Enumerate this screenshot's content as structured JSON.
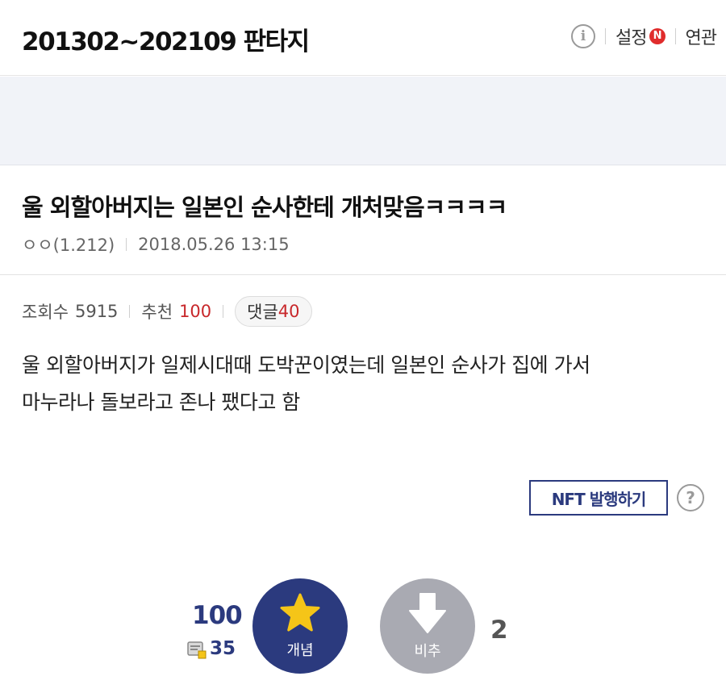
{
  "header": {
    "gallery_title": "201302~202109 판타지",
    "info_icon": "info-icon",
    "settings_label": "설정",
    "new_badge": "N",
    "related_label": "연관"
  },
  "post": {
    "title": "울 외할아버지는 일본인 순사한테 개처맞음ㅋㅋㅋㅋ",
    "author": "ㅇㅇ(1.212)",
    "date": "2018.05.26 13:15",
    "views_label": "조회수",
    "views": "5915",
    "recommend_label": "추천",
    "recommend_count": "100",
    "comments_label": "댓글",
    "comments_count": "40",
    "body_line1": "울 외할아버지가 일제시대때 도박꾼이였는데 일본인 순사가 집에 가서",
    "body_line2": "마누라나 돌보라고 존나 팼다고 함"
  },
  "actions": {
    "nft_label": "NFT 발행하기",
    "help_icon": "question-icon",
    "up_count": "100",
    "fixed_count": "35",
    "recommend_button_label": "개념",
    "down_button_label": "비추",
    "down_count": "2"
  },
  "colors": {
    "navy": "#2b3a7e",
    "red": "#c8282b",
    "gold": "#f5c518",
    "gray_button": "#a9aab2",
    "ad_band": "#f1f3f8"
  }
}
